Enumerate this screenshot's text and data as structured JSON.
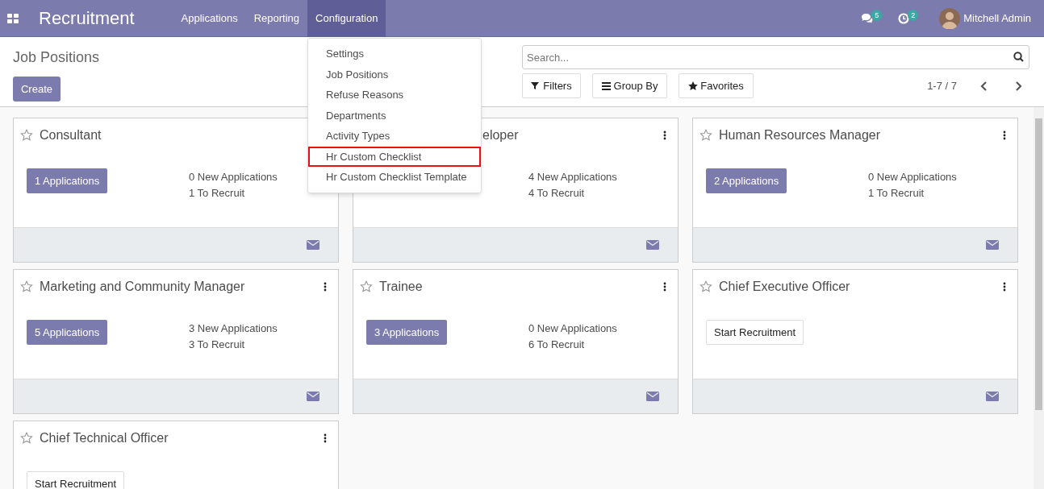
{
  "navbar": {
    "app_title": "Recruitment",
    "menus": [
      {
        "label": "Applications",
        "selected": false
      },
      {
        "label": "Reporting",
        "selected": false
      },
      {
        "label": "Configuration",
        "selected": true
      }
    ],
    "messages_count": "5",
    "activities_count": "2",
    "user": "Mitchell Admin"
  },
  "control_panel": {
    "title": "Job Positions",
    "create_button": "Create",
    "search": {
      "placeholder": "Search..."
    },
    "filters": [
      "Filters",
      "Group By",
      "Favorites"
    ],
    "pager": "1-7 / 7"
  },
  "dropdown": [
    {
      "label": "Settings",
      "highlighted": false
    },
    {
      "label": "Job Positions",
      "highlighted": false
    },
    {
      "label": "Refuse Reasons",
      "highlighted": false
    },
    {
      "label": "Departments",
      "highlighted": false
    },
    {
      "label": "Activity Types",
      "highlighted": false
    },
    {
      "label": "Hr Custom Checklist",
      "highlighted": true
    },
    {
      "label": "Hr Custom Checklist Template",
      "highlighted": false
    }
  ],
  "cards": [
    {
      "title": "Consultant",
      "kind": "applications",
      "button": "1 Applications",
      "new": "0 New Applications",
      "to_recruit": "1 To Recruit"
    },
    {
      "title": "eloper",
      "kind": "covered",
      "new": "4 New Applications",
      "to_recruit": "4 To Recruit"
    },
    {
      "title": "Human Resources Manager",
      "kind": "applications",
      "button": "2 Applications",
      "new": "0 New Applications",
      "to_recruit": "1 To Recruit"
    },
    {
      "title": "Marketing and Community Manager",
      "kind": "applications",
      "button": "5 Applications",
      "new": "3 New Applications",
      "to_recruit": "3 To Recruit"
    },
    {
      "title": "Trainee",
      "kind": "applications",
      "button": "3 Applications",
      "new": "0 New Applications",
      "to_recruit": "6 To Recruit"
    },
    {
      "title": "Chief Executive Officer",
      "kind": "start",
      "button": "Start Recruitment"
    },
    {
      "title": "Chief Technical Officer",
      "kind": "start",
      "button": "Start Recruitment"
    }
  ]
}
